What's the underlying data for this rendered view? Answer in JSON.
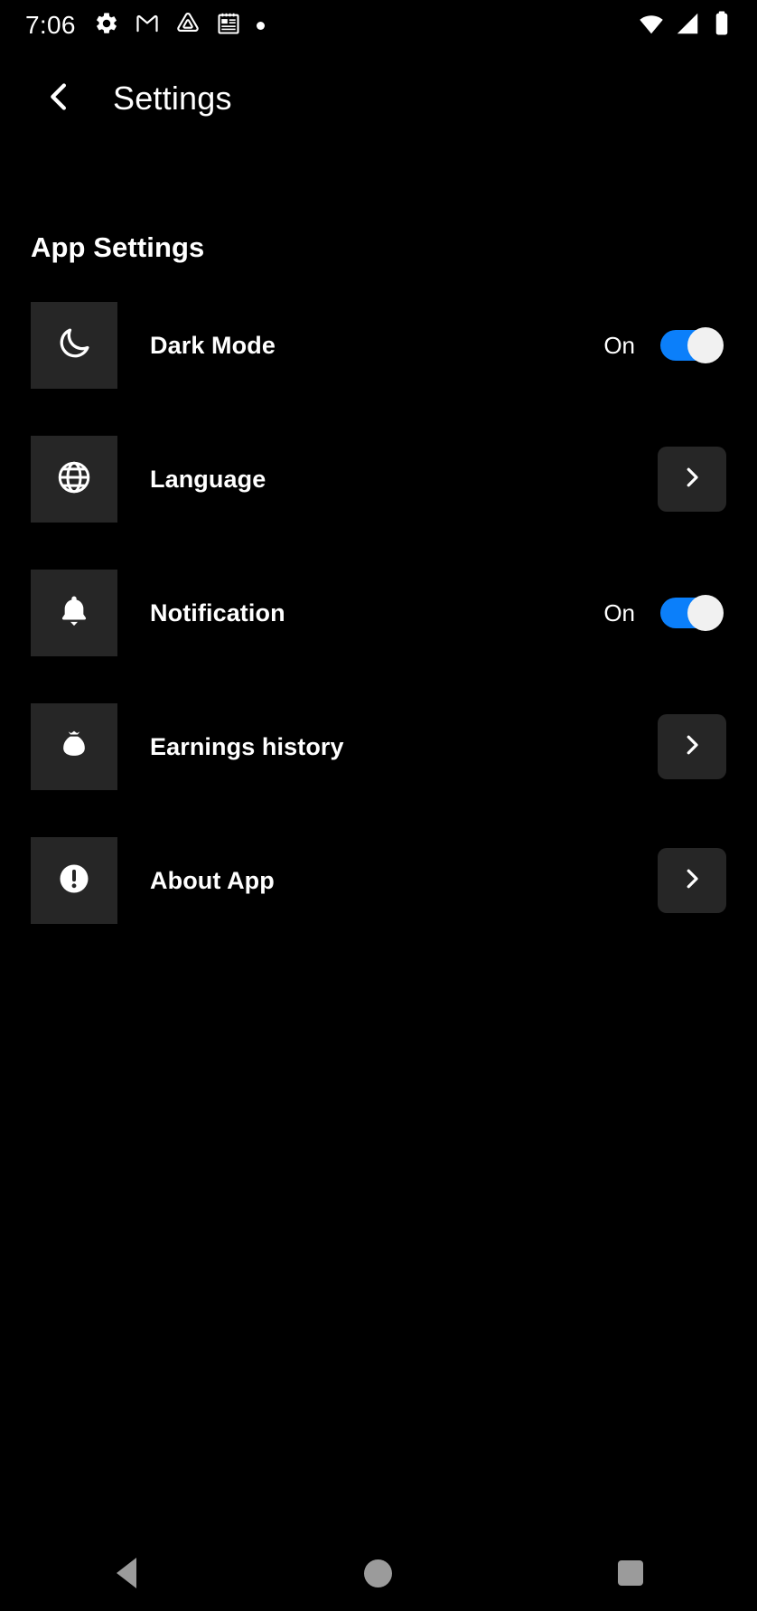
{
  "status_bar": {
    "time": "7:06",
    "left_icons": [
      {
        "name": "gear-icon"
      },
      {
        "name": "gmail-icon"
      },
      {
        "name": "drive-triangle-icon"
      },
      {
        "name": "notes-icon"
      },
      {
        "name": "more-dot-icon"
      }
    ],
    "right_icons": [
      {
        "name": "wifi-icon"
      },
      {
        "name": "cellular-signal-icon"
      },
      {
        "name": "battery-icon"
      }
    ]
  },
  "app_bar": {
    "back_icon": "chevron-left-icon",
    "title": "Settings"
  },
  "section": {
    "title": "App Settings"
  },
  "rows": [
    {
      "key": "dark-mode",
      "icon": "moon-icon",
      "label": "Dark Mode",
      "control": "toggle",
      "value": "On",
      "toggle_on": true
    },
    {
      "key": "language",
      "icon": "globe-icon",
      "label": "Language",
      "control": "chevron",
      "value": "",
      "chevron_icon": "chevron-right-icon"
    },
    {
      "key": "notification",
      "icon": "bell-icon",
      "label": "Notification",
      "control": "toggle",
      "value": "On",
      "toggle_on": true
    },
    {
      "key": "earnings-history",
      "icon": "money-bag-icon",
      "label": "Earnings history",
      "control": "chevron",
      "value": "",
      "chevron_icon": "chevron-right-icon"
    },
    {
      "key": "about-app",
      "icon": "info-circle-icon",
      "label": "About App",
      "control": "chevron",
      "value": "",
      "chevron_icon": "chevron-right-icon"
    }
  ],
  "nav_bar": {
    "back": "back-triangle-icon",
    "home": "home-circle-icon",
    "recents": "recents-square-icon"
  },
  "colors": {
    "background": "#000000",
    "tile": "#262626",
    "toggle_on": "#0B7FFA",
    "toggle_knob": "#f1f1f1",
    "text": "#ffffff",
    "nav_icon": "#9b9b9b"
  }
}
